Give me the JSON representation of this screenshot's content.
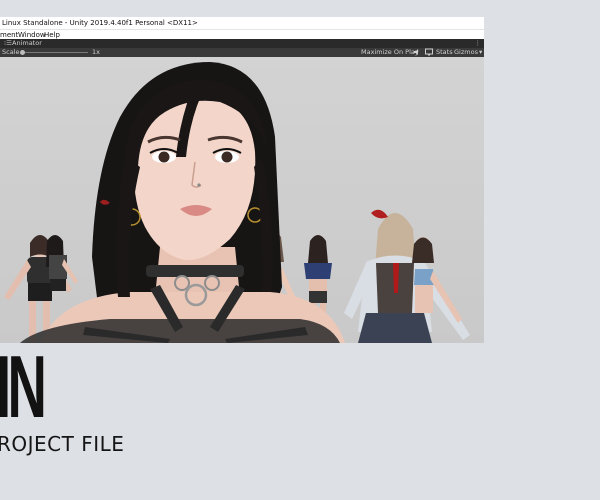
{
  "window": {
    "title": "Linux Standalone - Unity 2019.4.40f1 Personal <DX11>",
    "menu": [
      "ment",
      "Window",
      "Help"
    ]
  },
  "tabbar": {
    "tab_label": "Animator",
    "tab_icon": "animator-icon",
    "more_icon": "kebab-menu-icon"
  },
  "toolbar": {
    "scale_label": "Scale",
    "scale_value": "1x",
    "maximize_label": "Maximize On Play",
    "speaker_icon": "speaker-icon",
    "monitor_icon": "monitor-icon",
    "stats_label": "Stats",
    "gizmos_label": "Gizmos"
  },
  "page_text": {
    "big_letters": "IN",
    "subtitle": "ROJECT FILE"
  },
  "colors": {
    "page_bg": "#dde1e6",
    "titlebar_bg": "#ffffff",
    "tabbar_bg": "#2a2a2a",
    "toolbar_bg": "#3a3a3a",
    "viewport_bg": "#cfcfcf"
  }
}
